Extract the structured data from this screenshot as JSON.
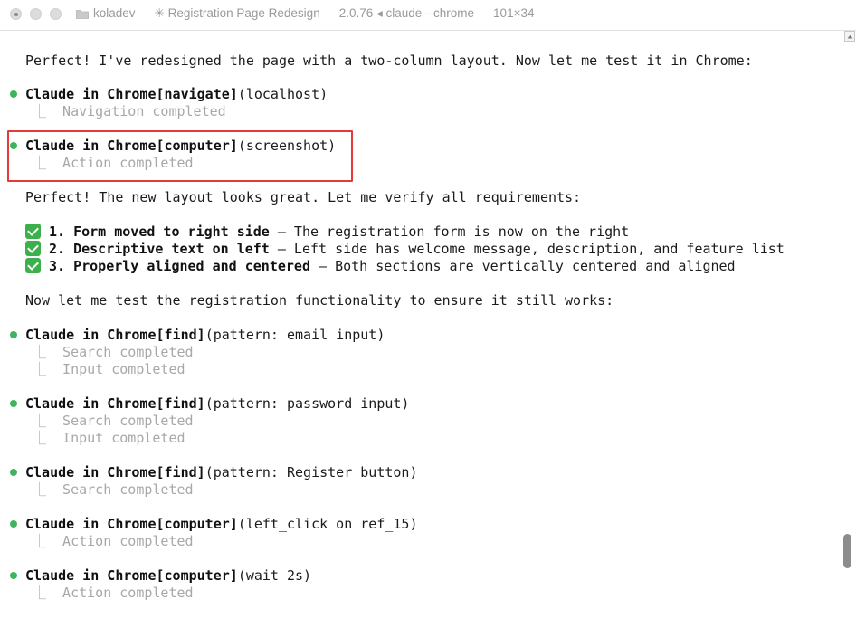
{
  "window": {
    "title": "koladev — ✳ Registration Page Redesign — 2.0.76 ◂ claude --chrome — 101×34"
  },
  "icons": {
    "folder": "folder-icon",
    "bullet": "bullet-dot-icon",
    "check": "check-mark-icon",
    "scroll_up": "scroll-up-arrow-icon"
  },
  "colors": {
    "bullet_green": "#3eb55c",
    "check_green": "#3cb04a",
    "highlight_red": "#e53a3a",
    "muted_text": "#a8a8a8"
  },
  "terminal": {
    "intro": "Perfect! I've redesigned the page with a two-column layout. Now let me test it in Chrome:",
    "tool_navigate": {
      "name": "Claude in Chrome[navigate]",
      "args": "(localhost)",
      "results": [
        "⎿  Navigation completed"
      ]
    },
    "tool_screenshot": {
      "name": "Claude in Chrome[computer]",
      "args": "(screenshot)",
      "results": [
        "⎿  Action completed"
      ]
    },
    "verify": "Perfect! The new layout looks great. Let me verify all requirements:",
    "requirements": [
      {
        "title": "1. Form moved to right side",
        "desc": " — The registration form is now on the right"
      },
      {
        "title": "2. Descriptive text on left",
        "desc": " — Left side has welcome message, description, and feature list"
      },
      {
        "title": "3. Properly aligned and centered",
        "desc": " — Both sections are vertically centered and aligned"
      }
    ],
    "test_intro": "Now let me test the registration functionality to ensure it still works:",
    "tool_find_email": {
      "name": "Claude in Chrome[find]",
      "args": "(pattern: email input)",
      "results": [
        "⎿  Search completed",
        "⎿  Input completed"
      ]
    },
    "tool_find_password": {
      "name": "Claude in Chrome[find]",
      "args": "(pattern: password input)",
      "results": [
        "⎿  Search completed",
        "⎿  Input completed"
      ]
    },
    "tool_find_register": {
      "name": "Claude in Chrome[find]",
      "args": "(pattern: Register button)",
      "results": [
        "⎿  Search completed"
      ]
    },
    "tool_click": {
      "name": "Claude in Chrome[computer]",
      "args": "(left_click on ref_15)",
      "results": [
        "⎿  Action completed"
      ]
    },
    "tool_wait": {
      "name": "Claude in Chrome[computer]",
      "args": "(wait 2s)",
      "results": [
        "⎿  Action completed"
      ]
    }
  }
}
